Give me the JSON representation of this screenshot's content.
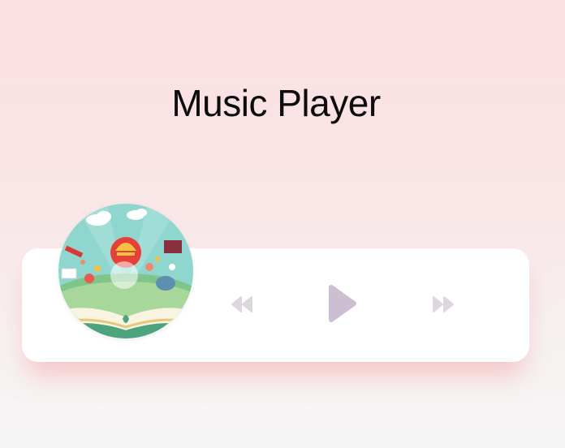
{
  "page": {
    "title": "Music Player"
  },
  "player": {
    "album_art": "album-cover-open-book-illustration",
    "controls": {
      "prev_icon": "backward-icon",
      "play_icon": "play-icon",
      "next_icon": "forward-icon"
    }
  },
  "colors": {
    "background_top": "#fcdfe0",
    "background_bottom": "#f6f5f5",
    "card": "#ffffff",
    "card_shadow": "#f5a0a5",
    "control_icon": "#dcd6dd",
    "play_icon": "#cdbfd2"
  }
}
